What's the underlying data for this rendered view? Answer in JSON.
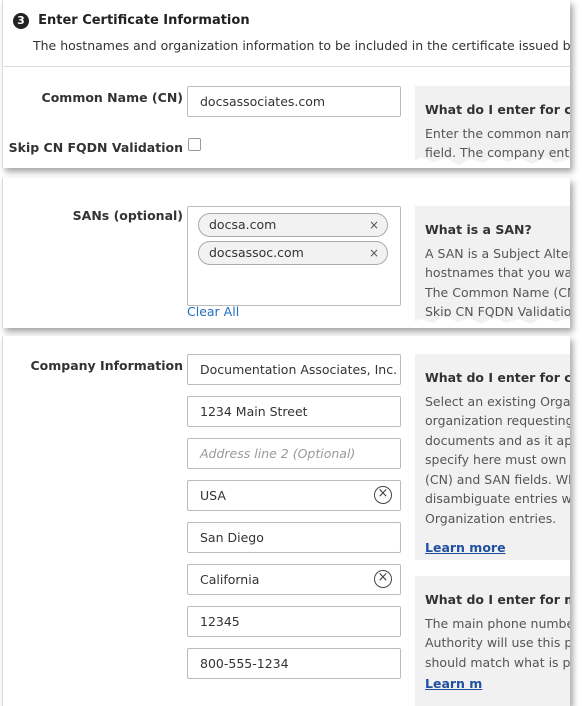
{
  "section": {
    "step_number": "3",
    "title": "Enter Certificate Information",
    "description": "The hostnames and organization information to be included in the certificate issued by the C"
  },
  "common_name": {
    "label": "Common Name (CN)",
    "value": "docsassociates.com",
    "help_title": "What do I enter for com",
    "help_lines": [
      "Enter the common name",
      "field. The company ente"
    ]
  },
  "skip_cn": {
    "label": "Skip CN FQDN Validation"
  },
  "sans": {
    "label": "SANs (optional)",
    "chips": [
      {
        "value": "docsa.com",
        "remove": "×"
      },
      {
        "value": "docsassoc.com",
        "remove": "×"
      }
    ],
    "clear_all": "Clear All",
    "help_title": "What is a SAN?",
    "help_lines": [
      "A SAN is a Subject Alter",
      "hostnames that you war",
      "The Common Name (CN",
      "Skip CN FQDN Validatio"
    ]
  },
  "company": {
    "label": "Company Information",
    "fields": {
      "org_name": "Documentation Associates, Inc.",
      "address1": "1234 Main Street",
      "address2_placeholder": "Address line 2 (Optional)",
      "country": "USA",
      "city": "San Diego",
      "state": "California",
      "postal_code": "12345",
      "phone": "800-555-1234"
    },
    "clear_icon": "⊗",
    "help1_title": "What do I enter for com",
    "help1_lines": [
      "Select an existing Organ",
      "organization requesting",
      "documents and as it app",
      "specify here must own",
      "(CN) and SAN fields.  Wh",
      "disambiguate entries wi",
      "Organization entries."
    ],
    "learn_more": "Learn more",
    "help2_title": "What do I enter for mai",
    "help2_lines": [
      "The main phone numbe",
      "Authority will use this p",
      "should match what is pu"
    ],
    "help2_link_partial": "Learn m"
  },
  "colors": {
    "link": "#1f4f9f",
    "help_bg": "#f1f1f1",
    "border": "#bbbbbb"
  }
}
